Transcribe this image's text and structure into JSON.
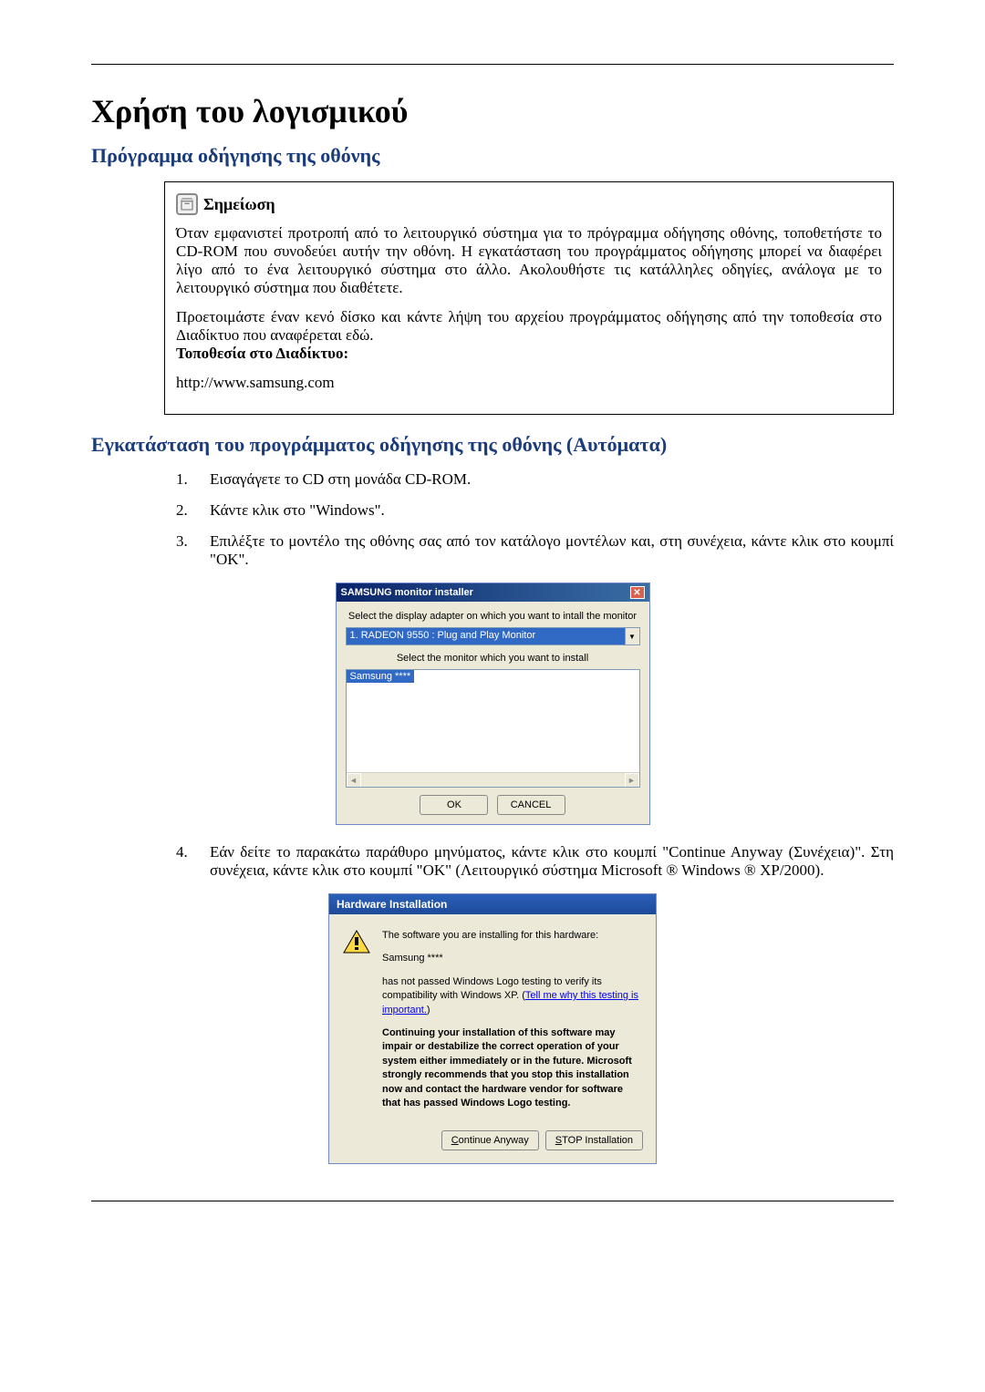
{
  "title": "Χρήση του λογισμικού",
  "section1": {
    "heading": "Πρόγραμμα οδήγησης της οθόνης",
    "note": {
      "title": "Σημείωση",
      "p1": "Όταν εμφανιστεί προτροπή από το λειτουργικό σύστημα για το πρόγραμμα οδήγησης οθόνης, τοποθετήστε το CD-ROM που συνοδεύει αυτήν την οθόνη. Η εγκατάσταση του προγράμματος οδήγησης μπορεί να διαφέρει λίγο από το ένα λειτουργικό σύστημα στο άλλο. Ακολουθήστε τις κατάλληλες οδηγίες, ανάλογα με το λειτουργικό σύστημα που διαθέτετε.",
      "p2": "Προετοιμάστε έναν κενό δίσκο και κάντε λήψη του αρχείου προγράμματος οδήγησης από την τοποθεσία στο Διαδίκτυο που αναφέρεται εδώ.",
      "label": "Τοποθεσία στο Διαδίκτυο:",
      "url": "http://www.samsung.com"
    }
  },
  "section2": {
    "heading": "Εγκατάσταση του προγράμματος οδήγησης της οθόνης (Αυτόματα)",
    "step1": "Εισαγάγετε το CD στη μονάδα CD-ROM.",
    "step2": "Κάντε κλικ στο \"Windows\".",
    "step3": "Επιλέξτε το μοντέλο της οθόνης σας από τον κατάλογο μοντέλων και, στη συνέχεια, κάντε κλικ στο κουμπί \"OK\".",
    "step4": "Εάν δείτε το παρακάτω παράθυρο μηνύματος, κάντε κλικ στο κουμπί \"Continue Anyway (Συνέχεια)\". Στη συνέχεια, κάντε κλικ στο κουμπί \"OK\" (Λειτουργικό σύστημα Microsoft ® Windows ® XP/2000)."
  },
  "installer": {
    "title": "SAMSUNG monitor installer",
    "label1": "Select the display adapter on which you want to intall the monitor",
    "adapter": "1. RADEON 9550 : Plug and Play Monitor",
    "label2": "Select the monitor which you want to install",
    "monitor": "Samsung ****",
    "ok": "OK",
    "cancel": "CANCEL"
  },
  "hardware": {
    "title": "Hardware Installation",
    "line1": "The software you are installing for this hardware:",
    "line2": "Samsung ****",
    "line3a": "has not passed Windows Logo testing to verify its compatibility with Windows XP. (",
    "link": "Tell me why this testing is important.",
    "line3b": ")",
    "bold": "Continuing your installation of this software may impair or destabilize the correct operation of your system either immediately or in the future. Microsoft strongly recommends that you stop this installation now and contact the hardware vendor for software that has passed Windows Logo testing.",
    "continue": "Continue Anyway",
    "stop": "STOP Installation"
  }
}
